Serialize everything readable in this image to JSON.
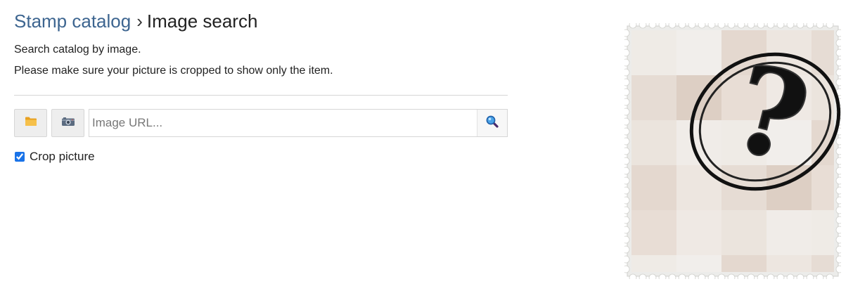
{
  "breadcrumb": {
    "parent": "Stamp catalog",
    "separator": "›",
    "current": "Image search"
  },
  "description": {
    "line1": "Search catalog by image.",
    "line2": "Please make sure your picture is cropped to show only the item."
  },
  "toolbar": {
    "folder_icon": "folder-icon",
    "camera_icon": "camera-icon",
    "search_icon": "magnifier-icon"
  },
  "url_field": {
    "placeholder": "Image URL...",
    "value": ""
  },
  "crop": {
    "label": "Crop picture",
    "checked": true
  },
  "stamp_image": {
    "symbol": "?"
  },
  "colors": {
    "link": "#3d6590",
    "checkbox": "#1a73e8",
    "folder": "#f6b93b",
    "magnifier": "#1e73be"
  }
}
